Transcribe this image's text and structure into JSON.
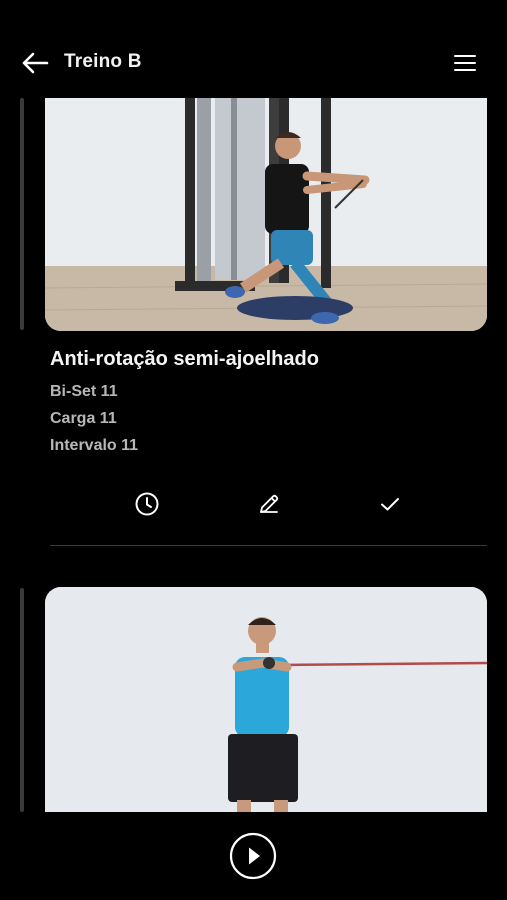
{
  "header": {
    "title": "Treino B",
    "back_icon": "arrow-left-icon",
    "menu_icon": "hamburger-menu-icon"
  },
  "exercises": [
    {
      "name": "Anti-rotação semi-ajoelhado",
      "details": [
        "Bi-Set 11",
        "Carga 11",
        "Intervalo 11"
      ],
      "actions": [
        "clock-icon",
        "pencil-icon",
        "check-icon"
      ]
    },
    {
      "name": "",
      "details": []
    }
  ],
  "footer": {
    "play_icon": "play-circle-icon"
  },
  "colors": {
    "background": "#000000",
    "title_text": "#f2f2f2",
    "detail_text": "#b7b7b7",
    "divider": "#3a3a3a"
  }
}
